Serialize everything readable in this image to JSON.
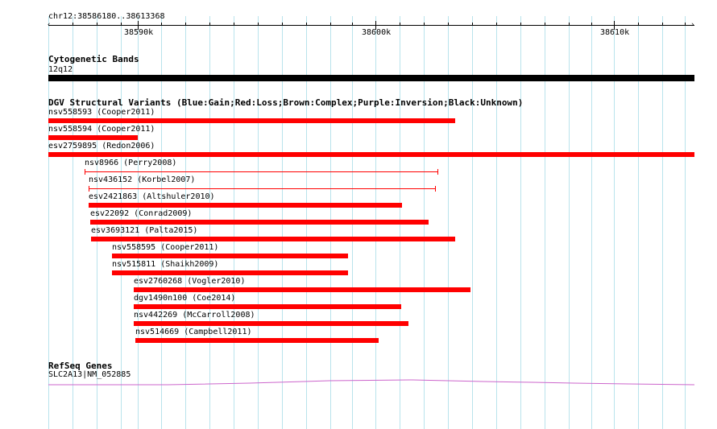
{
  "ruler": {
    "range_label": "chr12:38586180..38613368",
    "ticks": [
      "38590k",
      "38600k",
      "38610k"
    ]
  },
  "cytoband": {
    "title": "Cytogenetic Bands",
    "band_label": "12q12"
  },
  "dgv": {
    "title": "DGV Structural Variants (Blue:Gain;Red:Loss;Brown:Complex;Purple:Inversion;Black:Unknown)",
    "loss_color": "#ff0000",
    "variants": [
      {
        "label": "nsv558593 (Cooper2011)"
      },
      {
        "label": "nsv558594 (Cooper2011)"
      },
      {
        "label": "esv2759895 (Redon2006)"
      },
      {
        "label": "nsv8966 (Perry2008)"
      },
      {
        "label": "nsv436152 (Korbel2007)"
      },
      {
        "label": "esv2421863 (Altshuler2010)"
      },
      {
        "label": "esv22092 (Conrad2009)"
      },
      {
        "label": "esv3693121 (Palta2015)"
      },
      {
        "label": "nsv558595 (Cooper2011)"
      },
      {
        "label": "nsv515811 (Shaikh2009)"
      },
      {
        "label": "esv2760268 (Vogler2010)"
      },
      {
        "label": "dgv1490n100 (Coe2014)"
      },
      {
        "label": "nsv442269 (McCarroll2008)"
      },
      {
        "label": "nsv514669 (Campbell2011)"
      }
    ]
  },
  "refseq": {
    "title": "RefSeq Genes",
    "gene_label": "SLC2A13|NM_052885",
    "gene_color": "#cc66cc"
  }
}
